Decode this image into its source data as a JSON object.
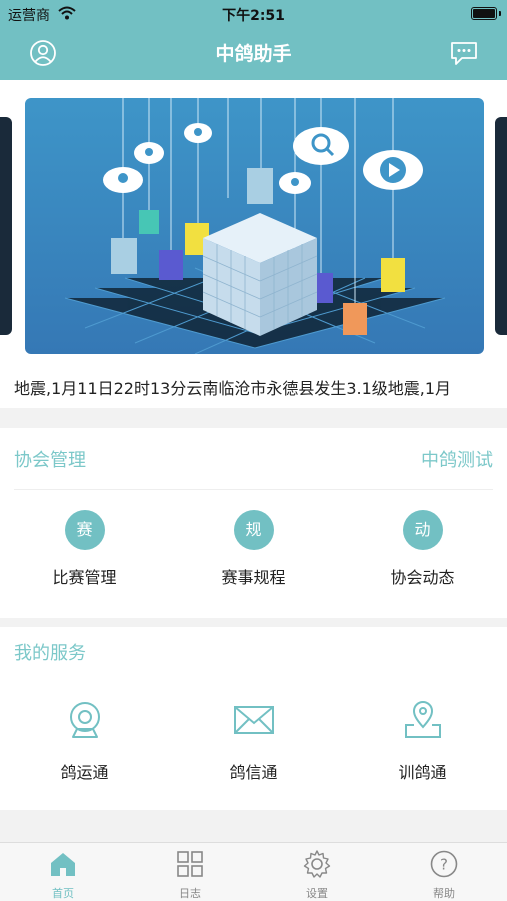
{
  "status_bar": {
    "carrier": "运营商",
    "time": "下午2:51"
  },
  "nav": {
    "title": "中鸽助手"
  },
  "marquee": {
    "text": "地震,1月11日22时13分云南临沧市永德县发生3.1级地震,1月"
  },
  "association": {
    "heading": "协会管理",
    "right_link": "中鸽测试",
    "items": [
      {
        "icon_char": "赛",
        "label": "比赛管理"
      },
      {
        "icon_char": "规",
        "label": "赛事规程"
      },
      {
        "icon_char": "动",
        "label": "协会动态"
      }
    ]
  },
  "services": {
    "heading": "我的服务",
    "items": [
      {
        "icon": "camera-icon",
        "label": "鸽运通"
      },
      {
        "icon": "envelope-icon",
        "label": "鸽信通"
      },
      {
        "icon": "location-pin-icon",
        "label": "训鸽通"
      }
    ]
  },
  "tabbar": {
    "items": [
      {
        "icon": "home-icon",
        "label": "首页",
        "active": true
      },
      {
        "icon": "grid-icon",
        "label": "日志",
        "active": false
      },
      {
        "icon": "gear-icon",
        "label": "设置",
        "active": false
      },
      {
        "icon": "help-icon",
        "label": "帮助",
        "active": false
      }
    ]
  },
  "colors": {
    "accent": "#72c0c3",
    "accent_light": "#7cc8c9",
    "banner_blue": "#3e95c8"
  }
}
